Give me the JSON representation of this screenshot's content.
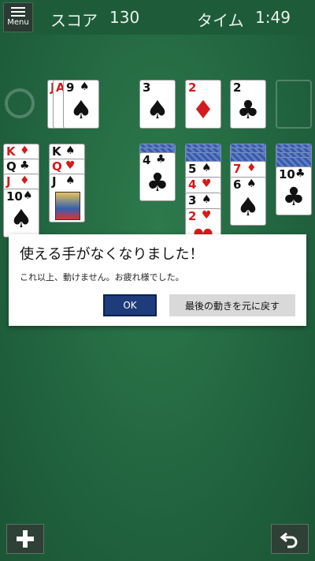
{
  "header": {
    "menu_label": "Menu",
    "score_label": "スコア",
    "score_value": "130",
    "time_label": "タイム",
    "time_value": "1:49"
  },
  "stock": {
    "top_cards": [
      {
        "rank": "J",
        "suit": "♠",
        "color": "red"
      },
      {
        "rank": "A",
        "suit": "♦",
        "color": "red"
      },
      {
        "rank": "9",
        "suit": "♠",
        "color": "black"
      }
    ]
  },
  "foundations": [
    {
      "rank": "3",
      "suit": "♠",
      "color": "black"
    },
    {
      "rank": "2",
      "suit": "♦",
      "color": "red"
    },
    {
      "rank": "2",
      "suit": "♣",
      "color": "black"
    }
  ],
  "tableau": [
    {
      "cards": [
        {
          "rank": "K",
          "suit": "♦",
          "color": "red"
        },
        {
          "rank": "Q",
          "suit": "♣",
          "color": "black"
        },
        {
          "rank": "J",
          "suit": "♦",
          "color": "red"
        },
        {
          "rank": "10",
          "suit": "♠",
          "color": "black"
        }
      ]
    },
    {
      "cards": [
        {
          "rank": "K",
          "suit": "♠",
          "color": "black"
        },
        {
          "rank": "Q",
          "suit": "♥",
          "color": "red"
        },
        {
          "rank": "J",
          "suit": "♠",
          "color": "black"
        }
      ]
    },
    {
      "cards": [
        {
          "rank": "4",
          "suit": "♣",
          "color": "black"
        }
      ]
    },
    {
      "cards": [
        {
          "rank": "5",
          "suit": "♠",
          "color": "black"
        },
        {
          "rank": "4",
          "suit": "♥",
          "color": "red"
        },
        {
          "rank": "3",
          "suit": "♠",
          "color": "black"
        },
        {
          "rank": "2",
          "suit": "♥",
          "color": "red"
        }
      ]
    },
    {
      "cards": [
        {
          "rank": "7",
          "suit": "♦",
          "color": "red"
        },
        {
          "rank": "6",
          "suit": "♠",
          "color": "black"
        }
      ]
    },
    {
      "cards": [
        {
          "rank": "10",
          "suit": "♣",
          "color": "black"
        }
      ]
    }
  ],
  "dialog": {
    "title": "使える手がなくなりました！",
    "message": "これ以上、動けません。お疲れ様でした。",
    "ok_label": "OK",
    "undo_label": "最後の動きを元に戻す"
  },
  "footer": {
    "add_icon": "plus-icon",
    "undo_icon": "undo-arrow-icon"
  },
  "colors": {
    "felt": "#226540",
    "card_red": "#d41b1b",
    "ok_button": "#1e3c7c"
  }
}
